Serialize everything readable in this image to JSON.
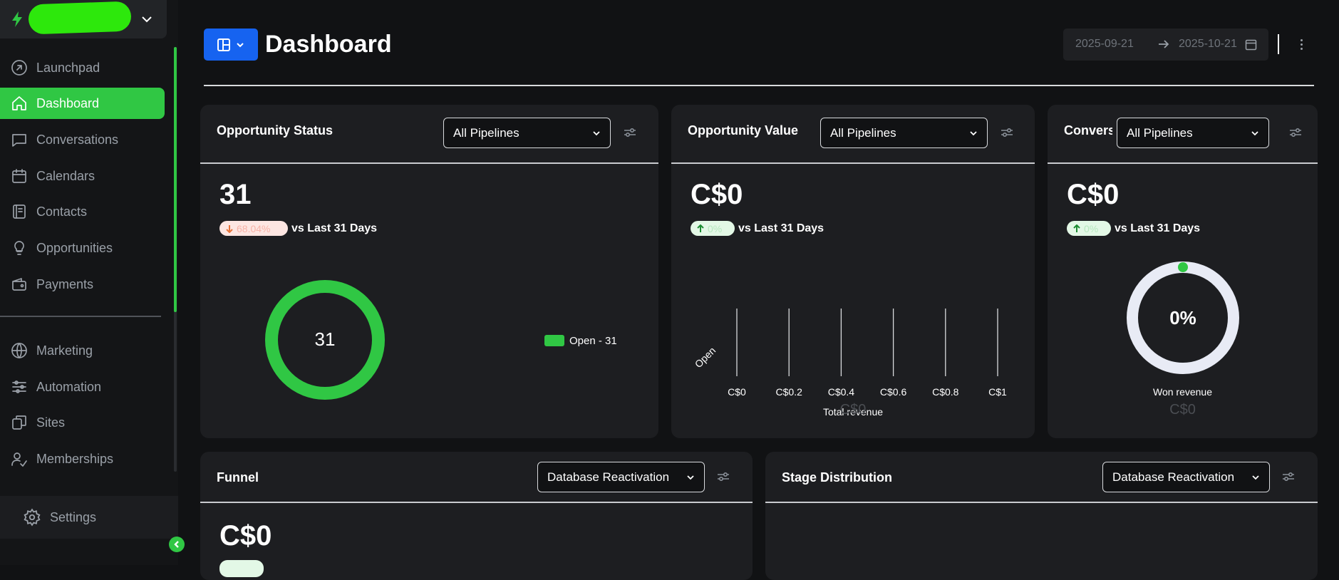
{
  "sidebar": {
    "items": [
      {
        "label": "Launchpad",
        "icon": "launchpad-icon"
      },
      {
        "label": "Dashboard",
        "icon": "home-icon",
        "active": true
      },
      {
        "label": "Conversations",
        "icon": "chat-icon"
      },
      {
        "label": "Calendars",
        "icon": "calendar-icon"
      },
      {
        "label": "Contacts",
        "icon": "contacts-icon"
      },
      {
        "label": "Opportunities",
        "icon": "lightbulb-icon"
      },
      {
        "label": "Payments",
        "icon": "wallet-icon"
      },
      {
        "label": "Marketing",
        "icon": "globe-icon"
      },
      {
        "label": "Automation",
        "icon": "sliders-icon"
      },
      {
        "label": "Sites",
        "icon": "sites-icon"
      },
      {
        "label": "Memberships",
        "icon": "user-check-icon"
      }
    ],
    "settings_label": "Settings"
  },
  "header": {
    "title": "Dashboard",
    "date_start": "2025-09-21",
    "date_end": "2025-10-21"
  },
  "colors": {
    "accent": "#30c744",
    "primary": "#1663f0",
    "ring_track": "#e8ebf5"
  },
  "cards": {
    "opportunity_status": {
      "title": "Opportunity Status",
      "filter": "All Pipelines",
      "value": "31",
      "change": "68.04%",
      "change_direction": "down",
      "vs_label": "vs Last 31 Days",
      "donut_center": "31",
      "legend": "Open - 31"
    },
    "opportunity_value": {
      "title": "Opportunity Value",
      "filter": "All Pipelines",
      "value": "C$0",
      "change": "0%",
      "change_direction": "up",
      "vs_label": "vs Last 31 Days",
      "chart_category": "Open",
      "ticks": [
        "C$0",
        "C$0.2",
        "C$0.4",
        "C$0.6",
        "C$0.8",
        "C$1"
      ],
      "axis_title": "Total revenue",
      "total": "C$0"
    },
    "conversion": {
      "title": "Conversion Rate",
      "filter": "All Pipelines",
      "value": "C$0",
      "change": "0%",
      "change_direction": "up",
      "vs_label": "vs Last 31 Days",
      "ring_value": "0%",
      "ring_caption": "Won revenue",
      "won_total": "C$0"
    },
    "funnel": {
      "title": "Funnel",
      "filter": "Database Reactivation",
      "value": "C$0"
    },
    "stage_distribution": {
      "title": "Stage Distribution",
      "filter": "Database Reactivation"
    }
  },
  "chart_data": [
    {
      "type": "pie",
      "categories": [
        "Open"
      ],
      "values": [
        31
      ]
    },
    {
      "type": "bar",
      "categories": [
        "Open"
      ],
      "values": [
        0
      ],
      "xlabel": "Total revenue",
      "xlim": [
        0,
        1
      ],
      "xticks": [
        "C$0",
        "C$0.2",
        "C$0.4",
        "C$0.6",
        "C$0.8",
        "C$1"
      ]
    }
  ]
}
